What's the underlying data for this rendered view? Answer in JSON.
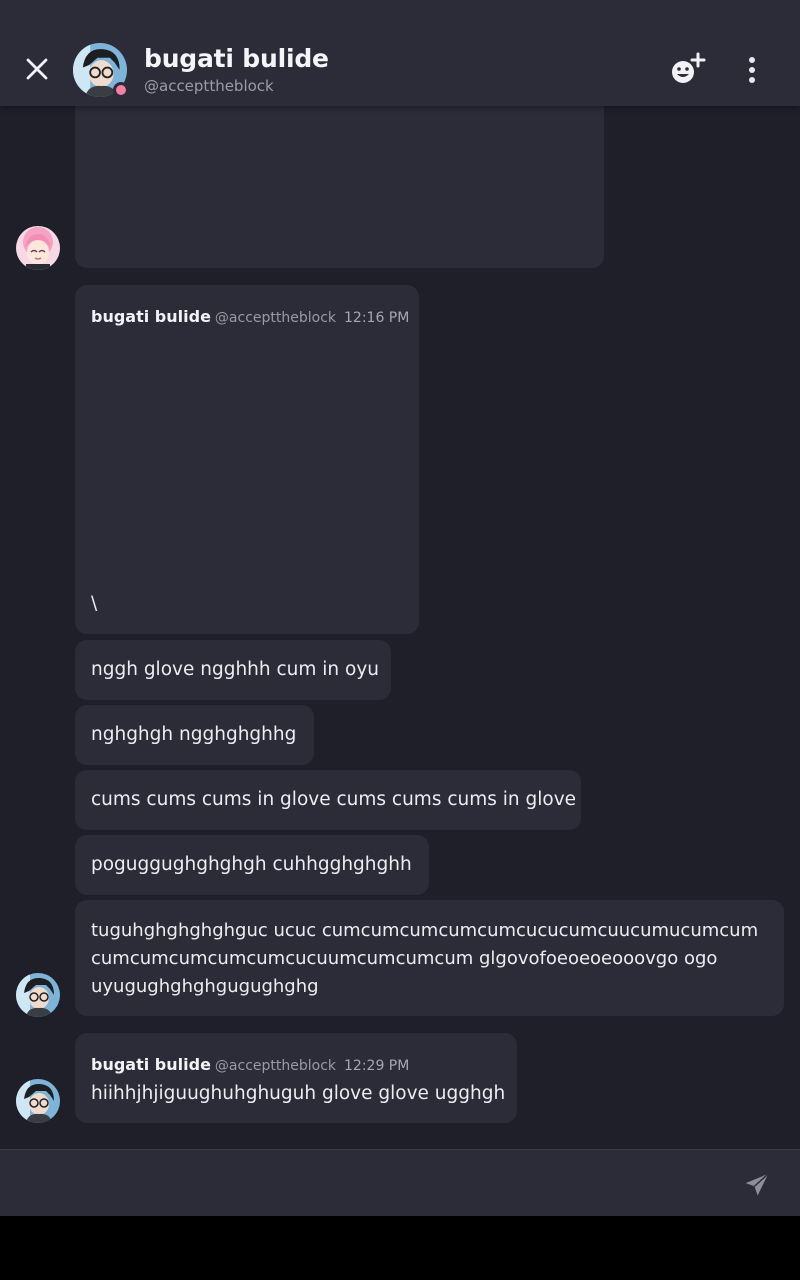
{
  "header": {
    "name": "bugati bulide",
    "handle": "@accepttheblock",
    "status_color": "#f47fa4"
  },
  "icons": {
    "close": "close-icon",
    "add_friend": "add-friend-icon",
    "more": "more-vertical-icon",
    "send": "send-icon"
  },
  "messages": [
    {
      "author": "",
      "handle": "",
      "time": "",
      "text": ""
    },
    {
      "author": "bugati bulide",
      "handle": "@accepttheblock",
      "time": "12:16 PM",
      "text": "\\"
    },
    {
      "text": "nggh glove ngghhh cum in oyu"
    },
    {
      "text": "nghghgh ngghghghhg"
    },
    {
      "text": "cums cums cums in glove cums cums cums in glove"
    },
    {
      "text": "poguggughghghgh cuhhgghghghh"
    },
    {
      "lines": [
        "tuguhghghghghguc ucuc cumcumcumcumcumcucucumcuucumucumcum",
        "cumcumcumcumcumcucuumcumcumcum glgovofoeoeoeooovgo ogo",
        "uyugughghghgugughghg"
      ]
    },
    {
      "author": "bugati bulide",
      "handle": "@accepttheblock",
      "time": "12:29 PM",
      "text": "hiihhjhjiguughuhghuguh glove glove ugghgh"
    }
  ],
  "composer": {
    "placeholder": ""
  },
  "colors": {
    "background": "#1e1f29",
    "bubble": "#2b2c37",
    "header": "#2b2c37",
    "accent_pink": "#f47fa4"
  }
}
